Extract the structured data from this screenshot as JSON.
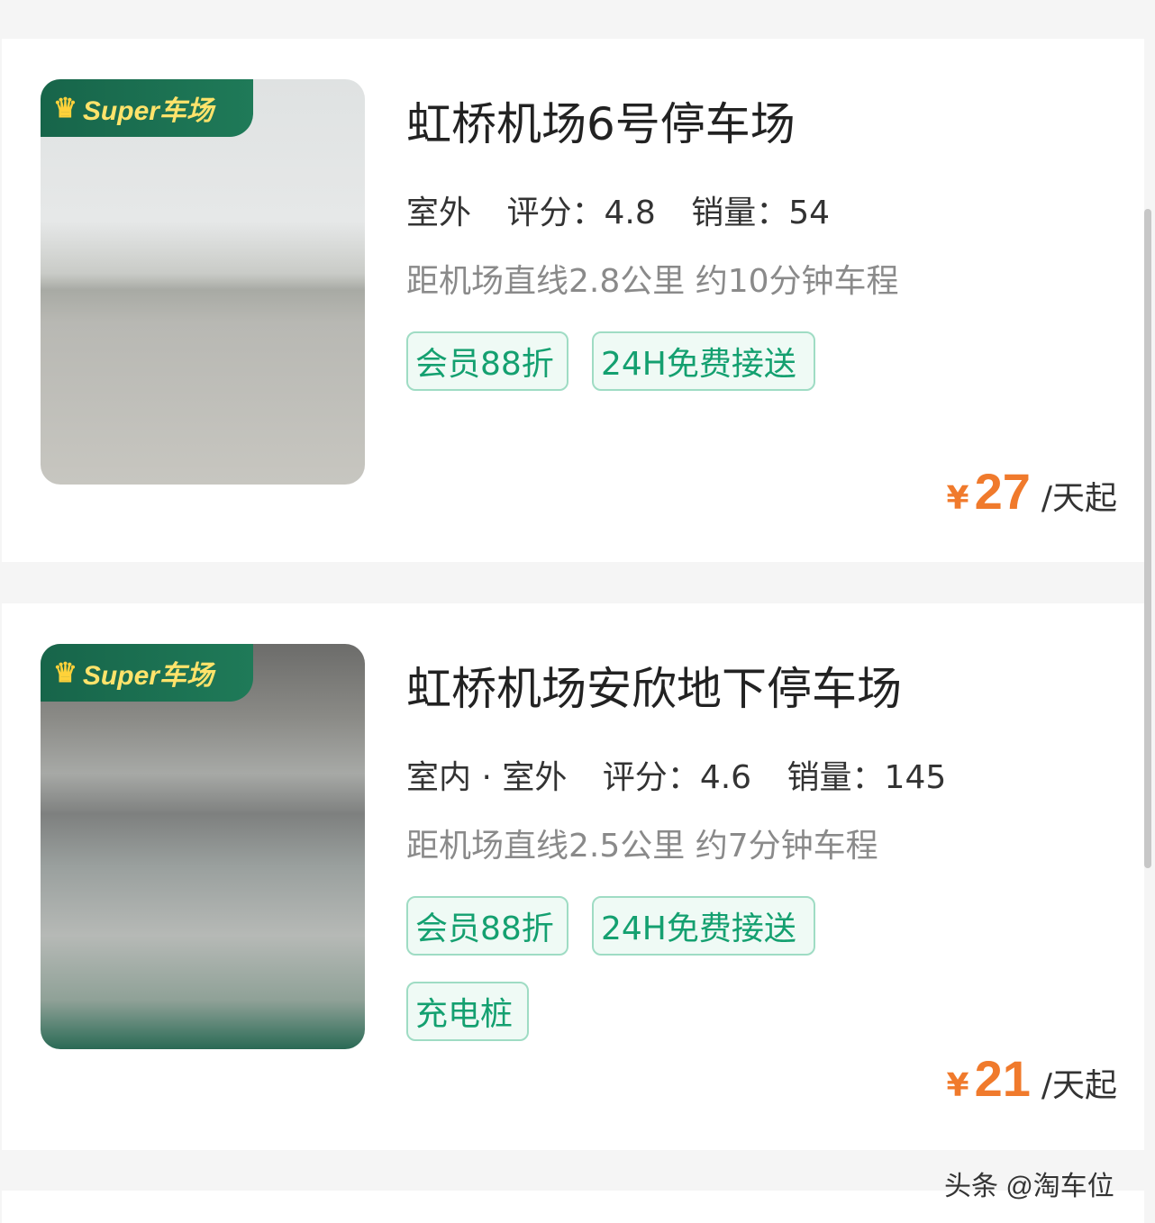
{
  "listings": [
    {
      "badge": "Super车场",
      "name": "虹桥机场6号停车场",
      "environment": "室外",
      "rating_label": "评分：",
      "rating": "4.8",
      "sales_label": "销量：",
      "sales": "54",
      "distance": "距机场直线2.8公里 约10分钟车程",
      "tags": [
        "会员88折",
        "24H免费接送"
      ],
      "price_currency": "¥",
      "price": "27",
      "price_unit": "/天起"
    },
    {
      "badge": "Super车场",
      "name": "虹桥机场安欣地下停车场",
      "environment": "室内 · 室外",
      "rating_label": "评分：",
      "rating": "4.6",
      "sales_label": "销量：",
      "sales": "145",
      "distance": "距机场直线2.5公里 约7分钟车程",
      "tags": [
        "会员88折",
        "24H免费接送",
        "充电桩"
      ],
      "price_currency": "¥",
      "price": "21",
      "price_unit": "/天起"
    }
  ],
  "watermark": "头条 @淘车位",
  "colors": {
    "accent_green": "#14a070",
    "price_orange": "#f07a2c",
    "badge_green": "#17654a",
    "badge_text": "#ffe36b"
  }
}
